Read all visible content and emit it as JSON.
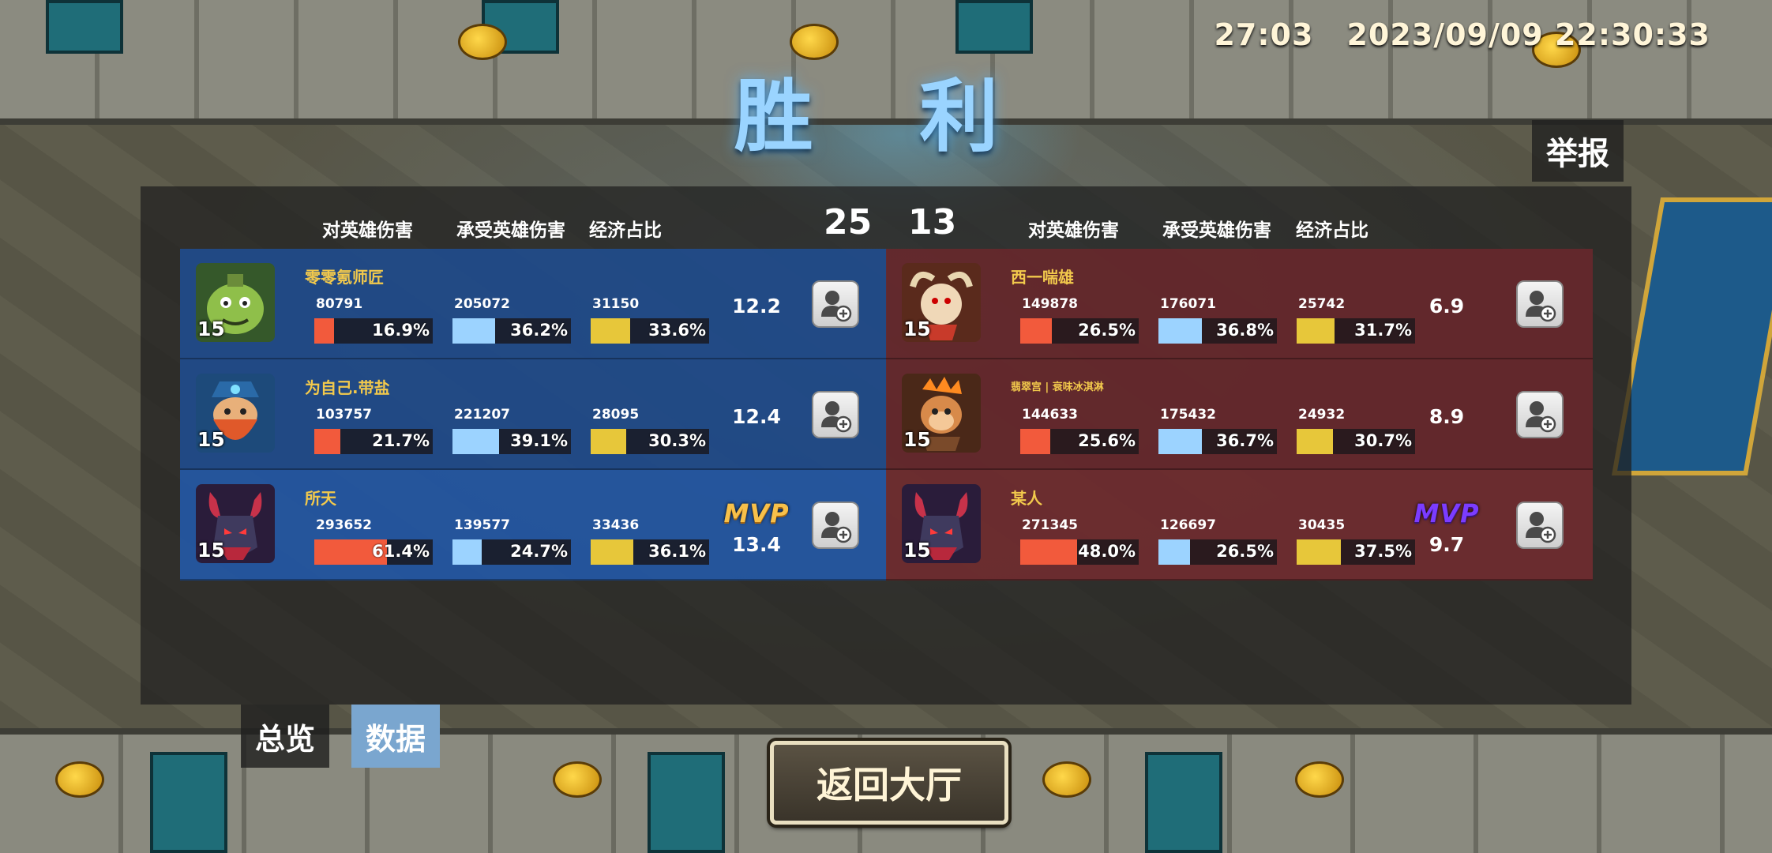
{
  "header": {
    "game_time": "27:03",
    "datetime": "2023/09/09 22:30:33",
    "result_title": "胜 利",
    "report_label": "举报"
  },
  "columns": {
    "left": [
      "对英雄伤害",
      "承受英雄伤害",
      "经济占比"
    ],
    "right": [
      "对英雄伤害",
      "承受英雄伤害",
      "经济占比"
    ]
  },
  "scores": {
    "left": "25",
    "right": "13"
  },
  "colors": {
    "damage": "#f25a3c",
    "taken": "#9cd3ff",
    "economy": "#e7c73a",
    "victory": "#9ad4ff",
    "player_name": "#f2c94c",
    "mvp_win": "#f7c04a",
    "mvp_lose": "#7b3cff"
  },
  "team_left": [
    {
      "name": "零零氪师匠",
      "level": "15",
      "hero_icon": "green-ogre-hero",
      "damage": "80791",
      "damage_pct": "16.9%",
      "damage_frac": 0.169,
      "taken": "205072",
      "taken_pct": "36.2%",
      "taken_frac": 0.362,
      "gold": "31150",
      "gold_pct": "33.6%",
      "gold_frac": 0.336,
      "rating": "12.2",
      "mvp": ""
    },
    {
      "name": "为自己.带盐",
      "level": "15",
      "hero_icon": "dwarf-captain-hero",
      "damage": "103757",
      "damage_pct": "21.7%",
      "damage_frac": 0.217,
      "taken": "221207",
      "taken_pct": "39.1%",
      "taken_frac": 0.391,
      "gold": "28095",
      "gold_pct": "30.3%",
      "gold_frac": 0.303,
      "rating": "12.4",
      "mvp": ""
    },
    {
      "name": "所天",
      "level": "15",
      "hero_icon": "horned-demon-hero",
      "damage": "293652",
      "damage_pct": "61.4%",
      "damage_frac": 0.614,
      "taken": "139577",
      "taken_pct": "24.7%",
      "taken_frac": 0.247,
      "gold": "33436",
      "gold_pct": "36.1%",
      "gold_frac": 0.361,
      "rating": "13.4",
      "mvp": "MVP"
    }
  ],
  "team_right": [
    {
      "name": "西一喘雄",
      "level": "15",
      "hero_icon": "horned-warrior-hero",
      "damage": "149878",
      "damage_pct": "26.5%",
      "damage_frac": 0.265,
      "taken": "176071",
      "taken_pct": "36.8%",
      "taken_frac": 0.368,
      "gold": "25742",
      "gold_pct": "31.7%",
      "gold_frac": 0.317,
      "rating": "6.9",
      "mvp": ""
    },
    {
      "name": "翡翠宫 | 衰味冰淇淋",
      "level": "15",
      "hero_icon": "fire-monkey-hero",
      "damage": "144633",
      "damage_pct": "25.6%",
      "damage_frac": 0.256,
      "taken": "175432",
      "taken_pct": "36.7%",
      "taken_frac": 0.367,
      "gold": "24932",
      "gold_pct": "30.7%",
      "gold_frac": 0.307,
      "rating": "8.9",
      "mvp": ""
    },
    {
      "name": "某人",
      "level": "15",
      "hero_icon": "horned-demon-hero",
      "damage": "271345",
      "damage_pct": "48.0%",
      "damage_frac": 0.48,
      "taken": "126697",
      "taken_pct": "26.5%",
      "taken_frac": 0.265,
      "gold": "30435",
      "gold_pct": "37.5%",
      "gold_frac": 0.375,
      "rating": "9.7",
      "mvp": "MVP"
    }
  ],
  "tabs": {
    "overview": "总览",
    "data": "数据"
  },
  "back_button": "返回大厅"
}
